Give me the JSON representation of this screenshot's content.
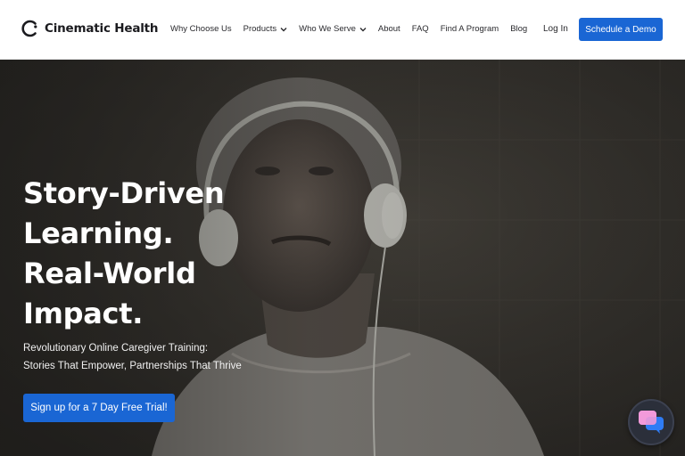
{
  "brand": {
    "name": "Cinematic Health"
  },
  "nav": {
    "items": [
      {
        "label": "Why Choose Us",
        "dropdown": false
      },
      {
        "label": "Products",
        "dropdown": true
      },
      {
        "label": "Who We Serve",
        "dropdown": true
      },
      {
        "label": "About",
        "dropdown": false
      },
      {
        "label": "FAQ",
        "dropdown": false
      },
      {
        "label": "Find A Program",
        "dropdown": false
      },
      {
        "label": "Blog",
        "dropdown": false
      }
    ],
    "login": "Log In",
    "demo": "Schedule a Demo"
  },
  "hero": {
    "title_lines": [
      "Story-Driven",
      "Learning.",
      "Real-World",
      "Impact."
    ],
    "subtitle_lines": [
      "Revolutionary Online Caregiver Training:",
      "Stories That Empower, Partnerships That Thrive"
    ],
    "cta": "Sign up for a 7 Day Free Trial!"
  },
  "colors": {
    "accent": "#1a66d4",
    "header_bg": "#ffffff",
    "hero_overlay": "#2a2825"
  },
  "icons": {
    "chat": "chat-bubbles-icon",
    "chevron": "chevron-down-icon"
  }
}
